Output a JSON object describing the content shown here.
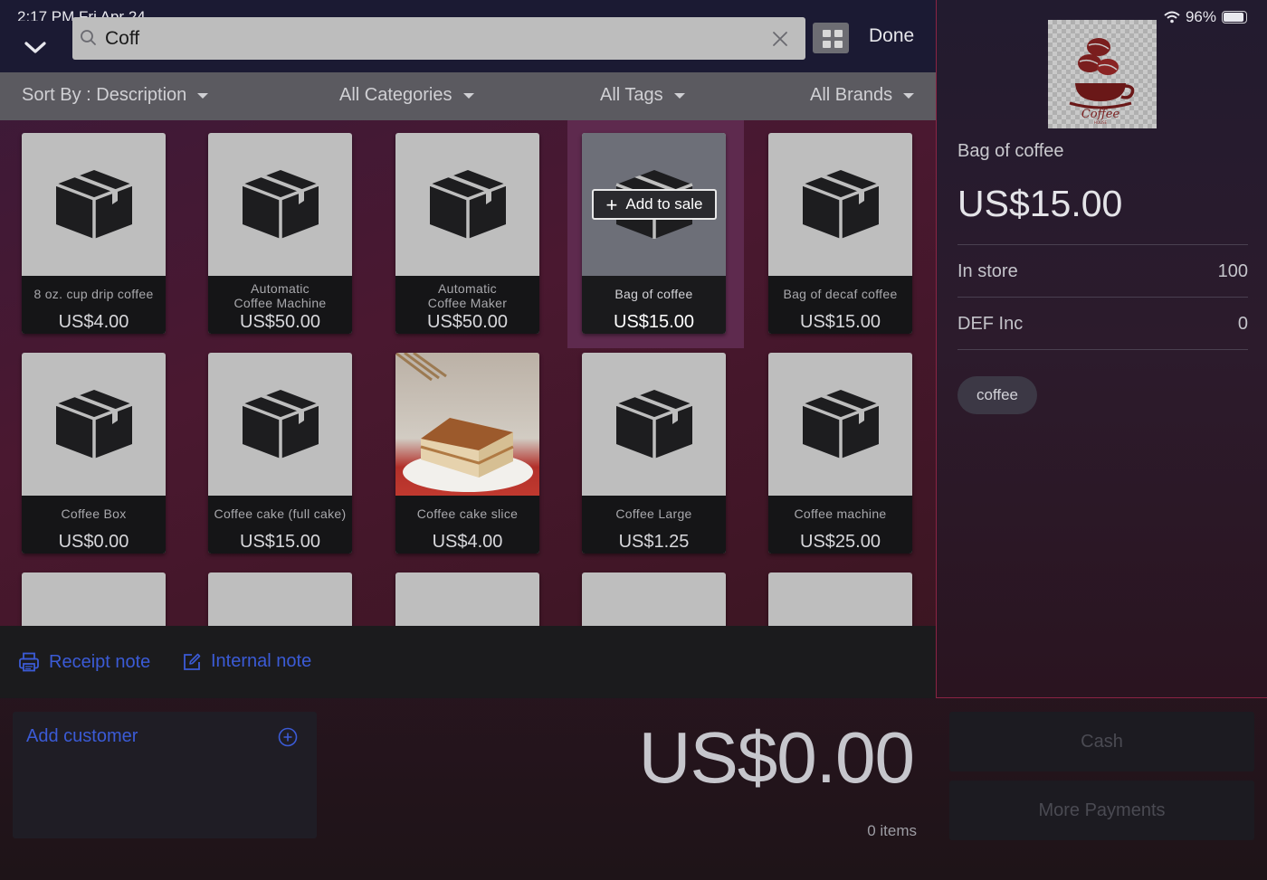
{
  "status": {
    "time": "2:17 PM  Fri Apr 24",
    "wifi_icon": "wifi-icon",
    "battery": "96%"
  },
  "search": {
    "value": "Coff",
    "placeholder": ""
  },
  "header": {
    "done_label": "Done"
  },
  "filters": {
    "sort": "Sort By : Description",
    "categories": "All Categories",
    "tags": "All Tags",
    "brands": "All Brands"
  },
  "products": [
    {
      "name": "8 oz. cup drip coffee",
      "price": "US$4.00"
    },
    {
      "name": "Automatic\nCoffee Machine",
      "price": "US$50.00"
    },
    {
      "name": "Automatic\nCoffee Maker",
      "price": "US$50.00"
    },
    {
      "name": "Bag of coffee",
      "price": "US$15.00",
      "selected": true,
      "action": "Add to sale"
    },
    {
      "name": "Bag of decaf coffee",
      "price": "US$15.00"
    },
    {
      "name": "Coffee Box",
      "price": "US$0.00"
    },
    {
      "name": "Coffee cake (full cake)",
      "price": "US$15.00"
    },
    {
      "name": "Coffee cake slice",
      "price": "US$4.00",
      "image": "coffee-cake-photo"
    },
    {
      "name": "Coffee Large",
      "price": "US$1.25"
    },
    {
      "name": "Coffee machine",
      "price": "US$25.00"
    }
  ],
  "notes": {
    "receipt": "Receipt note",
    "internal": "Internal note"
  },
  "detail": {
    "title": "Bag of coffee",
    "price": "US$15.00",
    "stock": [
      {
        "location": "In store",
        "qty": "100"
      },
      {
        "location": "DEF Inc",
        "qty": "0"
      }
    ],
    "tag": "coffee",
    "logo_text": "Coffee"
  },
  "sale": {
    "add_customer": "Add customer",
    "total": "US$0.00",
    "items": "0 items"
  },
  "payments": {
    "cash": "Cash",
    "more": "More Payments"
  },
  "colors": {
    "accent": "#3b5bd6",
    "selection": "#5e2a4e"
  }
}
